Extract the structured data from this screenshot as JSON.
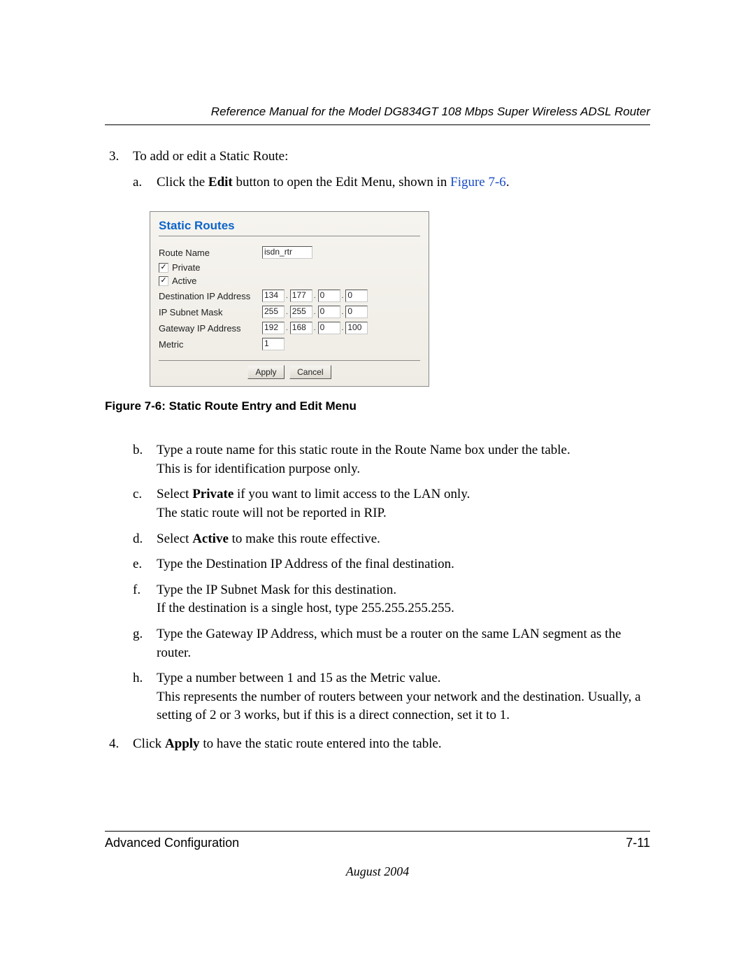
{
  "running_head": "Reference Manual for the Model DG834GT 108 Mbps Super Wireless ADSL Router",
  "step3": {
    "num": "3.",
    "text": "To add or edit a Static Route:",
    "a": {
      "letter": "a.",
      "pre": "Click the ",
      "bold": "Edit",
      "mid": " button to open the Edit Menu, shown in ",
      "link": "Figure 7-6",
      "post": "."
    }
  },
  "figure": {
    "title": "Static Routes",
    "route_name_label": "Route Name",
    "route_name_value": "isdn_rtr",
    "private_label": "Private",
    "active_label": "Active",
    "dest_label": "Destination IP Address",
    "dest": [
      "134",
      "177",
      "0",
      "0"
    ],
    "mask_label": "IP Subnet Mask",
    "mask": [
      "255",
      "255",
      "0",
      "0"
    ],
    "gw_label": "Gateway IP Address",
    "gw": [
      "192",
      "168",
      "0",
      "100"
    ],
    "metric_label": "Metric",
    "metric_value": "1",
    "apply": "Apply",
    "cancel": "Cancel"
  },
  "figure_caption": "Figure 7-6:  Static Route Entry and Edit Menu",
  "steps_alpha2": {
    "b": {
      "letter": "b.",
      "l1": "Type a route name for this static route in the Route Name box under the table.",
      "l2": "This is for identification purpose only."
    },
    "c": {
      "letter": "c.",
      "pre": "Select ",
      "bold": "Private",
      "post": " if you want to limit access to the LAN only.",
      "l2": "The static route will not be reported in RIP."
    },
    "d": {
      "letter": "d.",
      "pre": "Select ",
      "bold": "Active",
      "post": " to make this route effective."
    },
    "e": {
      "letter": "e.",
      "text": "Type the Destination IP Address of the final destination."
    },
    "f": {
      "letter": "f.",
      "l1": "Type the IP Subnet Mask for this destination.",
      "l2": "If the destination is a single host, type 255.255.255.255."
    },
    "g": {
      "letter": "g.",
      "text": "Type the Gateway IP Address, which must be a router on the same LAN segment as the router."
    },
    "h": {
      "letter": "h.",
      "l1": "Type a number between 1 and 15 as the Metric value.",
      "l2": "This represents the number of routers between your network and the destination. Usually, a setting of 2 or 3 works, but if this is a direct connection, set it to 1."
    }
  },
  "step4": {
    "num": "4.",
    "pre": "Click ",
    "bold": "Apply",
    "post": " to have the static route entered into the table."
  },
  "footer": {
    "section": "Advanced Configuration",
    "page": "7-11",
    "date": "August 2004"
  }
}
